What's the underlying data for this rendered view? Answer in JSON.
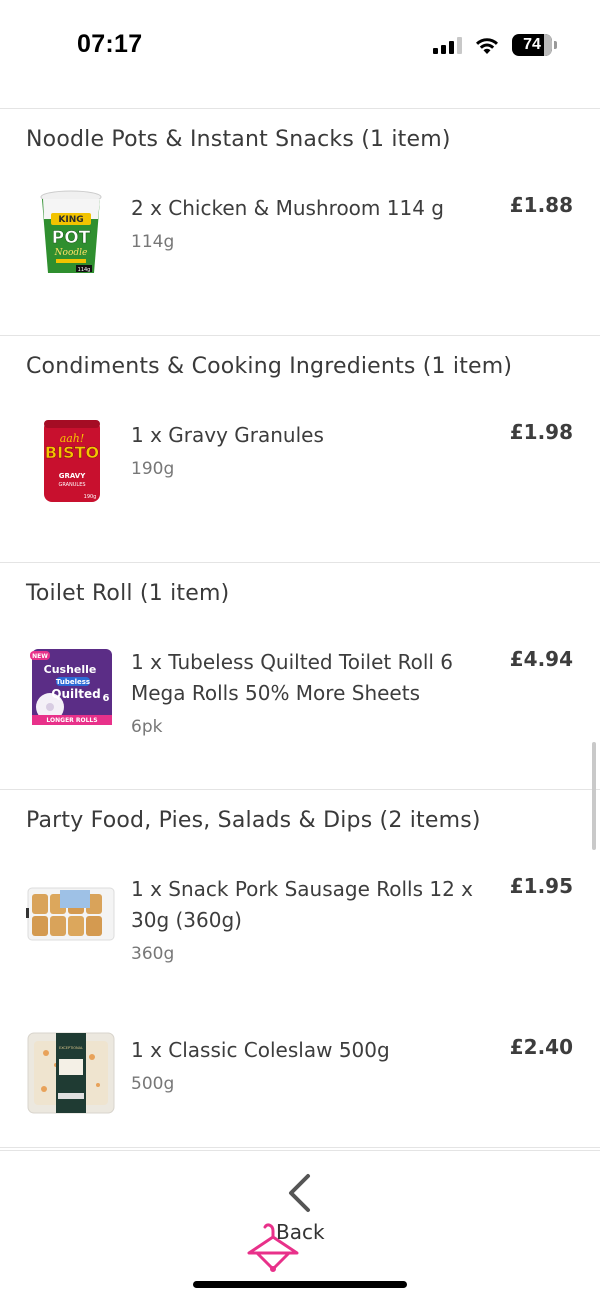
{
  "status_bar": {
    "time": "07:17",
    "battery": "74",
    "icons": [
      "cellular-signal-icon",
      "wifi-icon",
      "battery-icon"
    ]
  },
  "categories": [
    {
      "title": "Noodle Pots & Instant Snacks (1 item)",
      "items": [
        {
          "name": "2 x Chicken & Mushroom 114 g",
          "size": "114g",
          "price": "£1.88",
          "image": "pot-noodle-product-icon",
          "image_text": [
            "KING",
            "POT",
            "Noodle",
            "114g"
          ]
        }
      ]
    },
    {
      "title": "Condiments & Cooking Ingredients (1 item)",
      "items": [
        {
          "name": "1 x Gravy Granules",
          "size": "190g",
          "price": "£1.98",
          "image": "bisto-gravy-product-icon",
          "image_text": [
            "aah!",
            "BISTO",
            "GRAVY",
            "GRANULES",
            "190g"
          ]
        }
      ]
    },
    {
      "title": "Toilet Roll (1 item)",
      "items": [
        {
          "name": "1 x Tubeless Quilted Toilet Roll 6 Mega Rolls 50% More Sheets",
          "size": "6pk",
          "price": "£4.94",
          "image": "toilet-roll-product-icon",
          "image_text": [
            "NEW",
            "Cushelle",
            "Tubeless",
            "Quilted",
            "6",
            "LONGER ROLLS"
          ]
        }
      ]
    },
    {
      "title": "Party Food, Pies, Salads & Dips (2 items)",
      "items": [
        {
          "name": "1 x Snack Pork Sausage Rolls 12 x 30g (360g)",
          "size": "360g",
          "price": "£1.95",
          "image": "sausage-rolls-product-icon"
        },
        {
          "name": "1 x Classic Coleslaw 500g",
          "size": "500g",
          "price": "£2.40",
          "image": "coleslaw-product-icon",
          "image_text": [
            "EXCEPTIONAL"
          ]
        }
      ]
    }
  ],
  "bottom_bar": {
    "back_label": "Back",
    "icons": [
      "chevron-left-icon",
      "hanger-logo-icon"
    ]
  },
  "colors": {
    "accent_pink": "#e8318a",
    "divider": "#e4e4e4",
    "text_primary": "#3d3d3d",
    "text_secondary": "#777777"
  }
}
